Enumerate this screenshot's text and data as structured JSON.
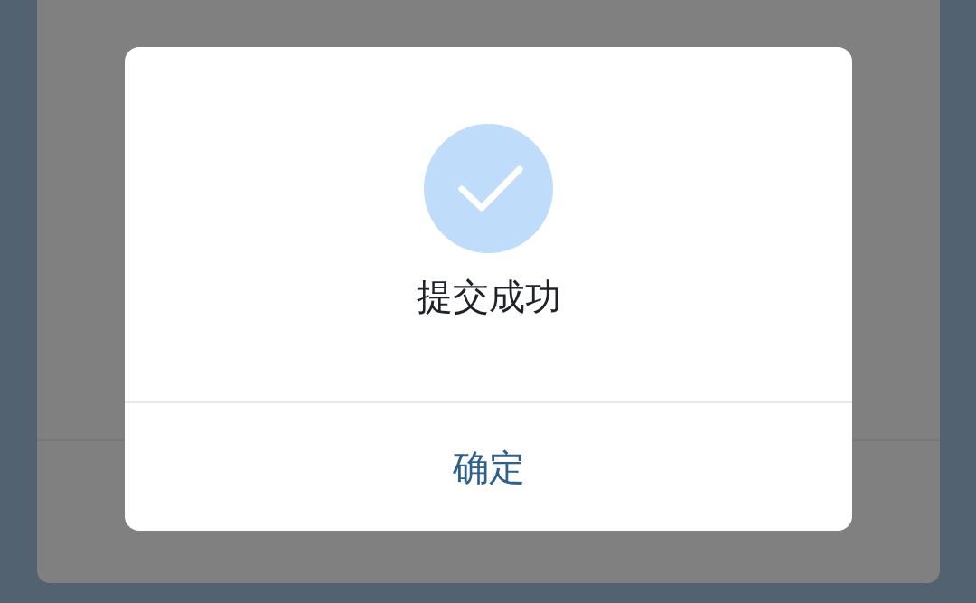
{
  "dialog": {
    "message": "提交成功",
    "button": "确定"
  }
}
